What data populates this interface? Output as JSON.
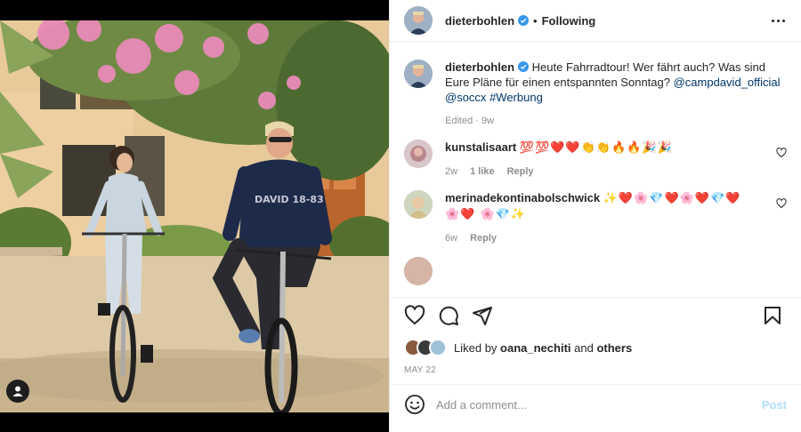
{
  "post": {
    "username": "dieterbohlen",
    "follow_status": "Following",
    "separator": "•",
    "caption": {
      "text": "Heute Fahrradtour! Wer fährt auch? Was sind Eure Pläne für einen entspannten Sonntag?",
      "mention1": "@campdavid_official",
      "mention2": "@soccx",
      "hashtag": "#Werbung",
      "meta": "Edited · 9w"
    },
    "shirt_print": "DAVID 18-83"
  },
  "comments": [
    {
      "username": "kunstalisaart",
      "text": "💯💯❤️❤️👏👏🔥🔥🎉🎉",
      "time": "2w",
      "likes": "1 like",
      "reply": "Reply"
    },
    {
      "username": "merinadekontinabolschwick",
      "text": "✨❤️🌸💎❤️🌸❤️💎❤️🌸❤️ 🌸💎✨",
      "time": "6w",
      "reply": "Reply"
    },
    {
      "username": "",
      "text": "",
      "time": ""
    }
  ],
  "likes_bar": {
    "prefix": "Liked by",
    "user": "oana_nechiti",
    "and": "and",
    "others": "others"
  },
  "date": "MAY 22",
  "add_comment": {
    "placeholder": "Add a comment...",
    "post_label": "Post"
  },
  "icons": {
    "more": "more-horizontal-icon",
    "like": "heart-icon",
    "comment": "comment-icon",
    "share": "share-icon",
    "save": "bookmark-icon",
    "emoji": "emoji-icon",
    "user_tag": "user-tag-icon",
    "verified": "verified-badge-icon"
  },
  "colors": {
    "link": "#00376b",
    "verified": "#3897f0",
    "muted": "#8e8e8e",
    "post_disabled": "#b2dffc"
  }
}
